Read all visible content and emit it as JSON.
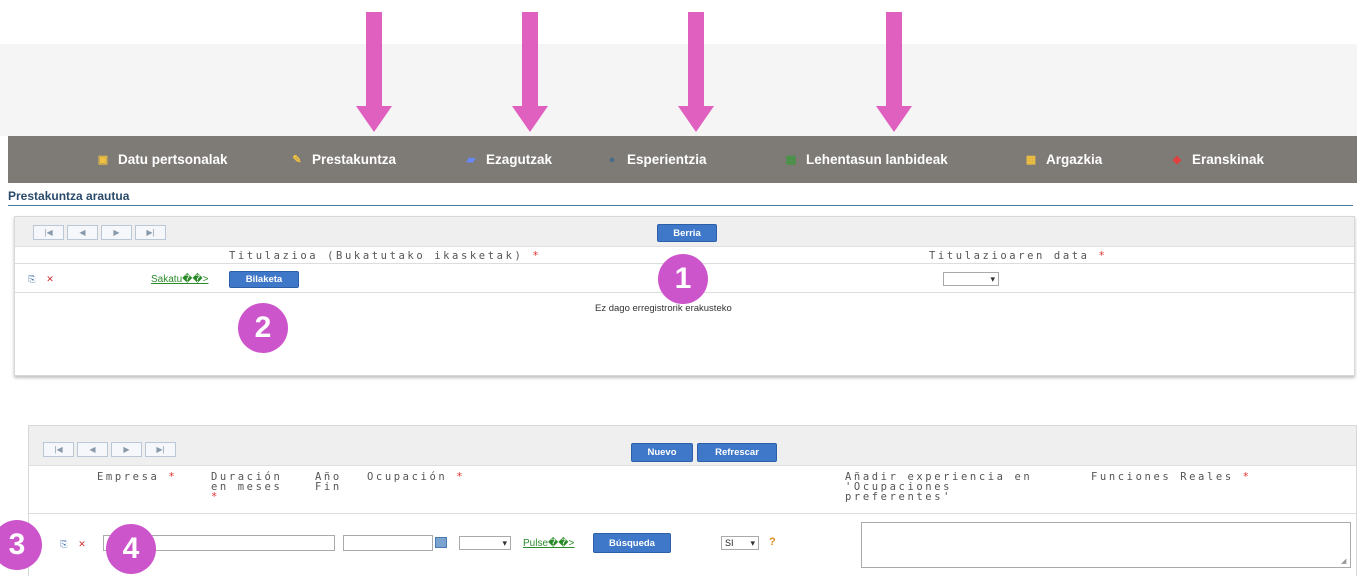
{
  "nav": {
    "items": [
      {
        "label": "Datu pertsonalak",
        "icon": "person-card-icon",
        "icon_color": "#f0c040"
      },
      {
        "label": "Prestakuntza",
        "icon": "pencil-icon",
        "icon_color": "#f0c040"
      },
      {
        "label": "Ezagutzak",
        "icon": "book-icon",
        "icon_color": "#6688ff"
      },
      {
        "label": "Esperientzia",
        "icon": "user-icon",
        "icon_color": "#4a6a8a"
      },
      {
        "label": "Lehentasun lanbideak",
        "icon": "document-star-icon",
        "icon_color": "#3a9a3a"
      },
      {
        "label": "Argazkia",
        "icon": "photo-icon",
        "icon_color": "#f0c040"
      },
      {
        "label": "Eranskinak",
        "icon": "attachment-icon",
        "icon_color": "#e04040"
      }
    ]
  },
  "section1": {
    "title": "Prestakuntza arautua",
    "new_button": "Berria",
    "columns": [
      "Titulazioa (Bukatutako ikasketak)",
      "Titulazioaren data"
    ],
    "required_mark": "*",
    "link": "Sakatu��>",
    "search_button": "Bilaketa",
    "empty_message": "Ez dago erregistrorik erakusteko"
  },
  "section2": {
    "new_button": "Nuevo",
    "refresh_button": "Refrescar",
    "col_empresa": "Empresa",
    "col_duracion_1": "Duración",
    "col_duracion_2": "en meses",
    "col_ano_1": "Año",
    "col_ano_2": "Fin",
    "col_ocupacion": "Ocupación",
    "col_anadir_1": "Añadir experiencia en",
    "col_anadir_2": "'Ocupaciones",
    "col_anadir_3": "preferentes'",
    "col_funciones": "Funciones Reales",
    "required_mark": "*",
    "link": "Pulse��>",
    "search_button": "Búsqueda",
    "si_value": "SI",
    "help": "?"
  },
  "badges": [
    "1",
    "2",
    "3",
    "4"
  ],
  "colors": {
    "navbar_bg": "#7e7b76",
    "arrow": "#e060c0",
    "badge": "#cc55cc",
    "button_blue": "#3f78c8",
    "link_green": "#2a8a2a",
    "required_red": "#e03030"
  }
}
